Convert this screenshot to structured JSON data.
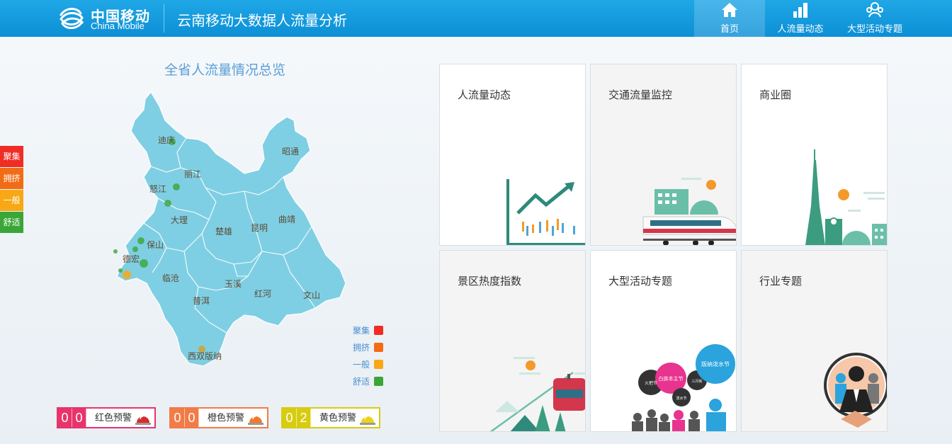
{
  "header": {
    "logo_cn": "中国移动",
    "logo_en": "China Mobile",
    "app_title": "云南移动大数据人流量分析",
    "nav": [
      {
        "label": "首页",
        "icon": "home-icon",
        "active": true
      },
      {
        "label": "人流量动态",
        "icon": "bar-chart-icon",
        "active": false
      },
      {
        "label": "大型活动专题",
        "icon": "crowd-icon",
        "active": false
      }
    ]
  },
  "status_tabs": [
    {
      "label": "聚集",
      "color": "#ef2d24"
    },
    {
      "label": "拥挤",
      "color": "#f26b15"
    },
    {
      "label": "一般",
      "color": "#f8a815"
    },
    {
      "label": "舒适",
      "color": "#3aa637"
    }
  ],
  "map": {
    "title": "全省人流量情况总览",
    "fill_color": "#7fcfe4",
    "cities": [
      "迪庆",
      "昭通",
      "丽江",
      "怒江",
      "大理",
      "楚雄",
      "昆明",
      "曲靖",
      "保山",
      "德宏",
      "临沧",
      "玉溪",
      "红河",
      "文山",
      "普洱",
      "西双版纳"
    ],
    "legend": [
      {
        "label": "聚集",
        "color": "#ef2d24"
      },
      {
        "label": "拥挤",
        "color": "#f26b15"
      },
      {
        "label": "一般",
        "color": "#f8a815"
      },
      {
        "label": "舒适",
        "color": "#3aa637"
      }
    ]
  },
  "warnings": [
    {
      "digits": [
        "0",
        "0"
      ],
      "label": "红色预警",
      "color": "#e8336b",
      "icon": "red-alarm-icon"
    },
    {
      "digits": [
        "0",
        "0"
      ],
      "label": "橙色预警",
      "color": "#f27b47",
      "icon": "orange-alarm-icon"
    },
    {
      "digits": [
        "0",
        "2"
      ],
      "label": "黄色预警",
      "color": "#d8cc10",
      "icon": "yellow-alarm-icon"
    }
  ],
  "tiles": [
    {
      "title": "人流量动态",
      "icon": "crowd-trend-illustration"
    },
    {
      "title": "交通流量监控",
      "icon": "train-city-illustration"
    },
    {
      "title": "商业圈",
      "icon": "city-tower-illustration"
    },
    {
      "title": "景区热度指数",
      "icon": "cable-car-illustration"
    },
    {
      "title": "大型活动专题",
      "icon": "festival-crowd-illustration"
    },
    {
      "title": "行业专题",
      "icon": "business-handshake-illustration"
    }
  ],
  "festival_bubbles": [
    "火把节",
    "白族本主节",
    "泼水节",
    "三月街",
    "版纳泼水节"
  ]
}
